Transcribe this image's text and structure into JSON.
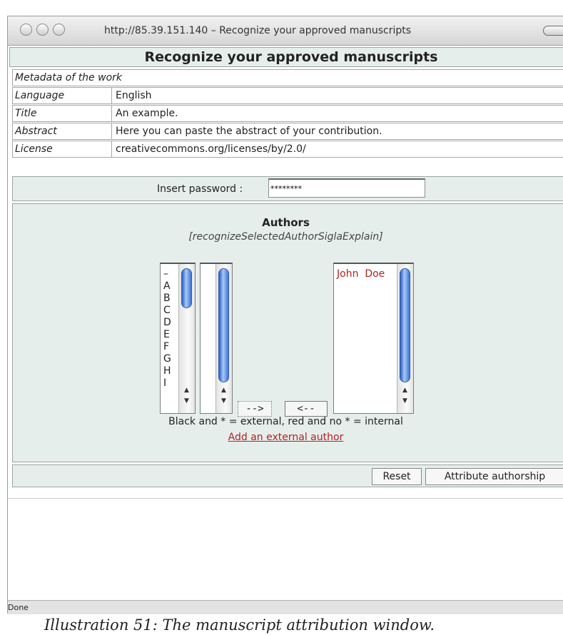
{
  "window": {
    "title": "http://85.39.151.140 – Recognize your approved manuscripts"
  },
  "page": {
    "heading": "Recognize your approved manuscripts",
    "metadata_header": "Metadata of the work",
    "metadata": [
      {
        "label": "Language",
        "value": "English"
      },
      {
        "label": "Title",
        "value": "An example."
      },
      {
        "label": "Abstract",
        "value": "Here you can paste the abstract of your contribution."
      },
      {
        "label": "License",
        "value": "creativecommons.org/licenses/by/2.0/"
      }
    ],
    "password": {
      "label": "Insert password :",
      "value": "********"
    },
    "authors": {
      "title": "Authors",
      "subtitle": "[recognizeSelectedAuthorSiglaExplain]",
      "letters": [
        "–",
        "A",
        "B",
        "C",
        "D",
        "E",
        "F",
        "G",
        "H",
        "I"
      ],
      "selected": [
        "John  Doe"
      ],
      "add_button": "-->",
      "remove_button": "<--",
      "note": "Black and * = external, red and no * = internal",
      "add_external_link": "Add an external author"
    },
    "actions": {
      "reset": "Reset",
      "attribute": "Attribute authorship"
    }
  },
  "status": {
    "text": "Done"
  },
  "caption": "Illustration 51: The manuscript attribution window."
}
